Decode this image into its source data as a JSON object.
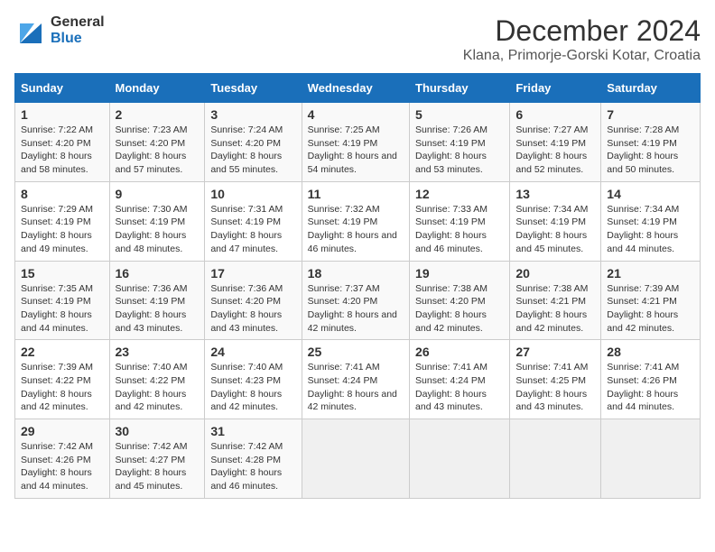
{
  "logo": {
    "general": "General",
    "blue": "Blue"
  },
  "title": "December 2024",
  "subtitle": "Klana, Primorje-Gorski Kotar, Croatia",
  "days_header": [
    "Sunday",
    "Monday",
    "Tuesday",
    "Wednesday",
    "Thursday",
    "Friday",
    "Saturday"
  ],
  "weeks": [
    [
      {
        "day": "1",
        "sunrise": "Sunrise: 7:22 AM",
        "sunset": "Sunset: 4:20 PM",
        "daylight": "Daylight: 8 hours and 58 minutes."
      },
      {
        "day": "2",
        "sunrise": "Sunrise: 7:23 AM",
        "sunset": "Sunset: 4:20 PM",
        "daylight": "Daylight: 8 hours and 57 minutes."
      },
      {
        "day": "3",
        "sunrise": "Sunrise: 7:24 AM",
        "sunset": "Sunset: 4:20 PM",
        "daylight": "Daylight: 8 hours and 55 minutes."
      },
      {
        "day": "4",
        "sunrise": "Sunrise: 7:25 AM",
        "sunset": "Sunset: 4:19 PM",
        "daylight": "Daylight: 8 hours and 54 minutes."
      },
      {
        "day": "5",
        "sunrise": "Sunrise: 7:26 AM",
        "sunset": "Sunset: 4:19 PM",
        "daylight": "Daylight: 8 hours and 53 minutes."
      },
      {
        "day": "6",
        "sunrise": "Sunrise: 7:27 AM",
        "sunset": "Sunset: 4:19 PM",
        "daylight": "Daylight: 8 hours and 52 minutes."
      },
      {
        "day": "7",
        "sunrise": "Sunrise: 7:28 AM",
        "sunset": "Sunset: 4:19 PM",
        "daylight": "Daylight: 8 hours and 50 minutes."
      }
    ],
    [
      {
        "day": "8",
        "sunrise": "Sunrise: 7:29 AM",
        "sunset": "Sunset: 4:19 PM",
        "daylight": "Daylight: 8 hours and 49 minutes."
      },
      {
        "day": "9",
        "sunrise": "Sunrise: 7:30 AM",
        "sunset": "Sunset: 4:19 PM",
        "daylight": "Daylight: 8 hours and 48 minutes."
      },
      {
        "day": "10",
        "sunrise": "Sunrise: 7:31 AM",
        "sunset": "Sunset: 4:19 PM",
        "daylight": "Daylight: 8 hours and 47 minutes."
      },
      {
        "day": "11",
        "sunrise": "Sunrise: 7:32 AM",
        "sunset": "Sunset: 4:19 PM",
        "daylight": "Daylight: 8 hours and 46 minutes."
      },
      {
        "day": "12",
        "sunrise": "Sunrise: 7:33 AM",
        "sunset": "Sunset: 4:19 PM",
        "daylight": "Daylight: 8 hours and 46 minutes."
      },
      {
        "day": "13",
        "sunrise": "Sunrise: 7:34 AM",
        "sunset": "Sunset: 4:19 PM",
        "daylight": "Daylight: 8 hours and 45 minutes."
      },
      {
        "day": "14",
        "sunrise": "Sunrise: 7:34 AM",
        "sunset": "Sunset: 4:19 PM",
        "daylight": "Daylight: 8 hours and 44 minutes."
      }
    ],
    [
      {
        "day": "15",
        "sunrise": "Sunrise: 7:35 AM",
        "sunset": "Sunset: 4:19 PM",
        "daylight": "Daylight: 8 hours and 44 minutes."
      },
      {
        "day": "16",
        "sunrise": "Sunrise: 7:36 AM",
        "sunset": "Sunset: 4:19 PM",
        "daylight": "Daylight: 8 hours and 43 minutes."
      },
      {
        "day": "17",
        "sunrise": "Sunrise: 7:36 AM",
        "sunset": "Sunset: 4:20 PM",
        "daylight": "Daylight: 8 hours and 43 minutes."
      },
      {
        "day": "18",
        "sunrise": "Sunrise: 7:37 AM",
        "sunset": "Sunset: 4:20 PM",
        "daylight": "Daylight: 8 hours and 42 minutes."
      },
      {
        "day": "19",
        "sunrise": "Sunrise: 7:38 AM",
        "sunset": "Sunset: 4:20 PM",
        "daylight": "Daylight: 8 hours and 42 minutes."
      },
      {
        "day": "20",
        "sunrise": "Sunrise: 7:38 AM",
        "sunset": "Sunset: 4:21 PM",
        "daylight": "Daylight: 8 hours and 42 minutes."
      },
      {
        "day": "21",
        "sunrise": "Sunrise: 7:39 AM",
        "sunset": "Sunset: 4:21 PM",
        "daylight": "Daylight: 8 hours and 42 minutes."
      }
    ],
    [
      {
        "day": "22",
        "sunrise": "Sunrise: 7:39 AM",
        "sunset": "Sunset: 4:22 PM",
        "daylight": "Daylight: 8 hours and 42 minutes."
      },
      {
        "day": "23",
        "sunrise": "Sunrise: 7:40 AM",
        "sunset": "Sunset: 4:22 PM",
        "daylight": "Daylight: 8 hours and 42 minutes."
      },
      {
        "day": "24",
        "sunrise": "Sunrise: 7:40 AM",
        "sunset": "Sunset: 4:23 PM",
        "daylight": "Daylight: 8 hours and 42 minutes."
      },
      {
        "day": "25",
        "sunrise": "Sunrise: 7:41 AM",
        "sunset": "Sunset: 4:24 PM",
        "daylight": "Daylight: 8 hours and 42 minutes."
      },
      {
        "day": "26",
        "sunrise": "Sunrise: 7:41 AM",
        "sunset": "Sunset: 4:24 PM",
        "daylight": "Daylight: 8 hours and 43 minutes."
      },
      {
        "day": "27",
        "sunrise": "Sunrise: 7:41 AM",
        "sunset": "Sunset: 4:25 PM",
        "daylight": "Daylight: 8 hours and 43 minutes."
      },
      {
        "day": "28",
        "sunrise": "Sunrise: 7:41 AM",
        "sunset": "Sunset: 4:26 PM",
        "daylight": "Daylight: 8 hours and 44 minutes."
      }
    ],
    [
      {
        "day": "29",
        "sunrise": "Sunrise: 7:42 AM",
        "sunset": "Sunset: 4:26 PM",
        "daylight": "Daylight: 8 hours and 44 minutes."
      },
      {
        "day": "30",
        "sunrise": "Sunrise: 7:42 AM",
        "sunset": "Sunset: 4:27 PM",
        "daylight": "Daylight: 8 hours and 45 minutes."
      },
      {
        "day": "31",
        "sunrise": "Sunrise: 7:42 AM",
        "sunset": "Sunset: 4:28 PM",
        "daylight": "Daylight: 8 hours and 46 minutes."
      },
      null,
      null,
      null,
      null
    ]
  ]
}
